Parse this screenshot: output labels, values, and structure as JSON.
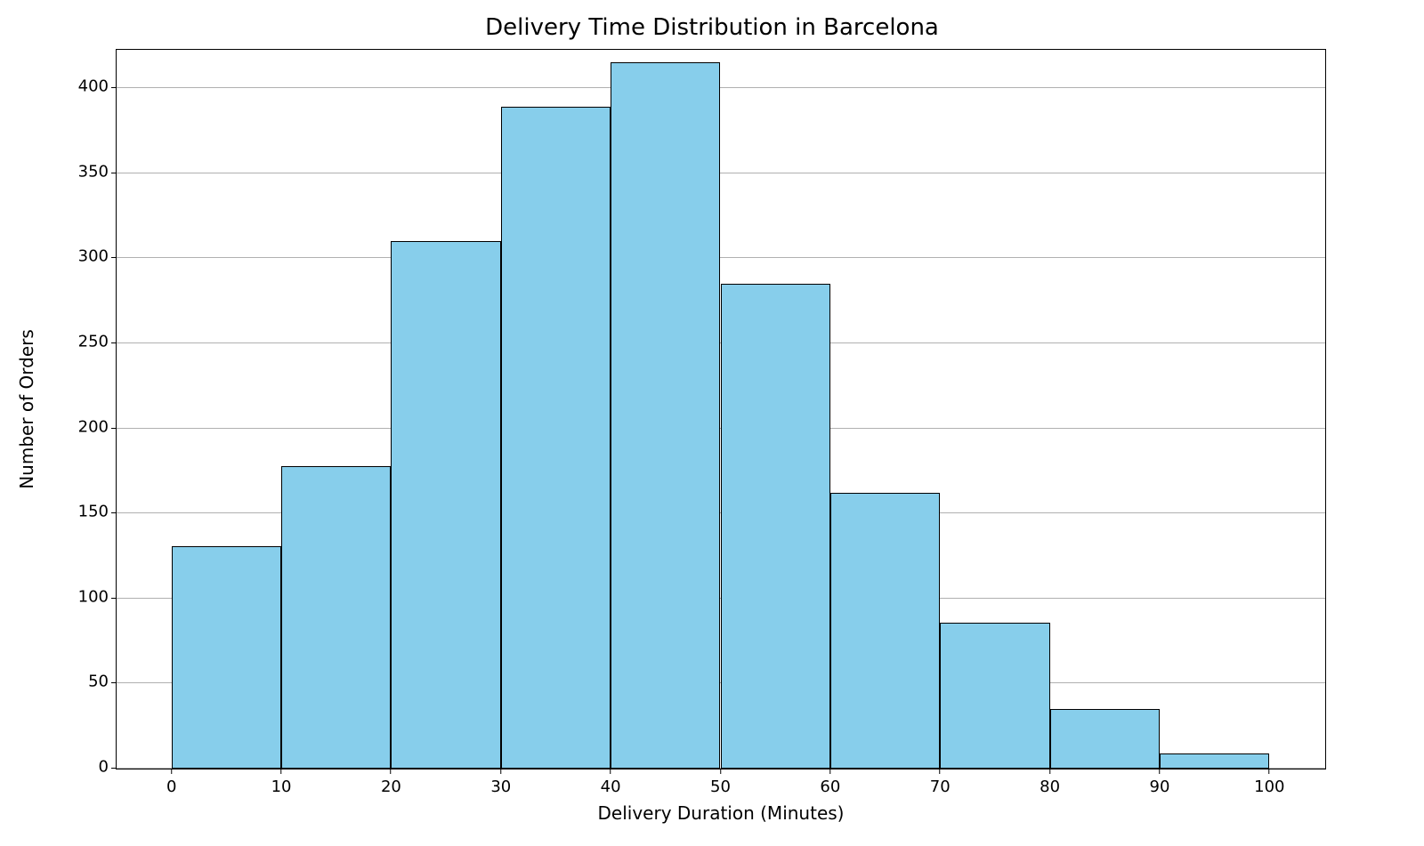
{
  "chart_data": {
    "type": "bar",
    "title": "Delivery Time Distribution in Barcelona",
    "xlabel": "Delivery Duration (Minutes)",
    "ylabel": "Number of Orders",
    "xlim": [
      -5,
      105
    ],
    "ylim": [
      0,
      422
    ],
    "xticks": [
      0,
      10,
      20,
      30,
      40,
      50,
      60,
      70,
      80,
      90,
      100
    ],
    "yticks": [
      0,
      50,
      100,
      150,
      200,
      250,
      300,
      350,
      400
    ],
    "bin_edges": [
      0,
      10,
      20,
      30,
      40,
      50,
      60,
      70,
      80,
      90,
      100
    ],
    "values": [
      131,
      178,
      310,
      389,
      415,
      285,
      162,
      86,
      35,
      9
    ],
    "bar_color": "#87ceeb",
    "edge_color": "#000000",
    "grid": true
  }
}
